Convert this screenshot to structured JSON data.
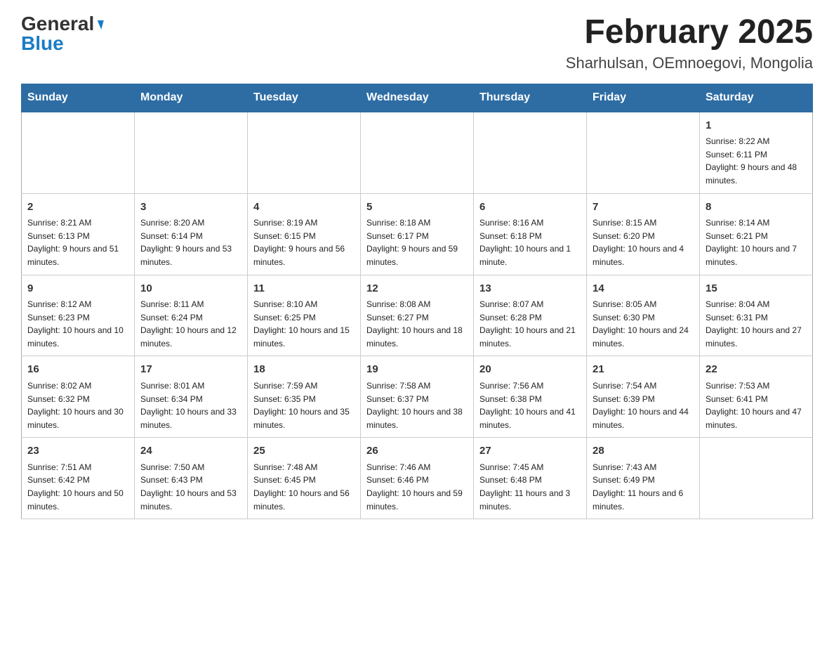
{
  "header": {
    "logo_general": "General",
    "logo_blue": "Blue",
    "month_title": "February 2025",
    "location": "Sharhulsan, OEmnoegovi, Mongolia"
  },
  "days_of_week": [
    "Sunday",
    "Monday",
    "Tuesday",
    "Wednesday",
    "Thursday",
    "Friday",
    "Saturday"
  ],
  "weeks": [
    [
      {
        "day": "",
        "info": ""
      },
      {
        "day": "",
        "info": ""
      },
      {
        "day": "",
        "info": ""
      },
      {
        "day": "",
        "info": ""
      },
      {
        "day": "",
        "info": ""
      },
      {
        "day": "",
        "info": ""
      },
      {
        "day": "1",
        "info": "Sunrise: 8:22 AM\nSunset: 6:11 PM\nDaylight: 9 hours and 48 minutes."
      }
    ],
    [
      {
        "day": "2",
        "info": "Sunrise: 8:21 AM\nSunset: 6:13 PM\nDaylight: 9 hours and 51 minutes."
      },
      {
        "day": "3",
        "info": "Sunrise: 8:20 AM\nSunset: 6:14 PM\nDaylight: 9 hours and 53 minutes."
      },
      {
        "day": "4",
        "info": "Sunrise: 8:19 AM\nSunset: 6:15 PM\nDaylight: 9 hours and 56 minutes."
      },
      {
        "day": "5",
        "info": "Sunrise: 8:18 AM\nSunset: 6:17 PM\nDaylight: 9 hours and 59 minutes."
      },
      {
        "day": "6",
        "info": "Sunrise: 8:16 AM\nSunset: 6:18 PM\nDaylight: 10 hours and 1 minute."
      },
      {
        "day": "7",
        "info": "Sunrise: 8:15 AM\nSunset: 6:20 PM\nDaylight: 10 hours and 4 minutes."
      },
      {
        "day": "8",
        "info": "Sunrise: 8:14 AM\nSunset: 6:21 PM\nDaylight: 10 hours and 7 minutes."
      }
    ],
    [
      {
        "day": "9",
        "info": "Sunrise: 8:12 AM\nSunset: 6:23 PM\nDaylight: 10 hours and 10 minutes."
      },
      {
        "day": "10",
        "info": "Sunrise: 8:11 AM\nSunset: 6:24 PM\nDaylight: 10 hours and 12 minutes."
      },
      {
        "day": "11",
        "info": "Sunrise: 8:10 AM\nSunset: 6:25 PM\nDaylight: 10 hours and 15 minutes."
      },
      {
        "day": "12",
        "info": "Sunrise: 8:08 AM\nSunset: 6:27 PM\nDaylight: 10 hours and 18 minutes."
      },
      {
        "day": "13",
        "info": "Sunrise: 8:07 AM\nSunset: 6:28 PM\nDaylight: 10 hours and 21 minutes."
      },
      {
        "day": "14",
        "info": "Sunrise: 8:05 AM\nSunset: 6:30 PM\nDaylight: 10 hours and 24 minutes."
      },
      {
        "day": "15",
        "info": "Sunrise: 8:04 AM\nSunset: 6:31 PM\nDaylight: 10 hours and 27 minutes."
      }
    ],
    [
      {
        "day": "16",
        "info": "Sunrise: 8:02 AM\nSunset: 6:32 PM\nDaylight: 10 hours and 30 minutes."
      },
      {
        "day": "17",
        "info": "Sunrise: 8:01 AM\nSunset: 6:34 PM\nDaylight: 10 hours and 33 minutes."
      },
      {
        "day": "18",
        "info": "Sunrise: 7:59 AM\nSunset: 6:35 PM\nDaylight: 10 hours and 35 minutes."
      },
      {
        "day": "19",
        "info": "Sunrise: 7:58 AM\nSunset: 6:37 PM\nDaylight: 10 hours and 38 minutes."
      },
      {
        "day": "20",
        "info": "Sunrise: 7:56 AM\nSunset: 6:38 PM\nDaylight: 10 hours and 41 minutes."
      },
      {
        "day": "21",
        "info": "Sunrise: 7:54 AM\nSunset: 6:39 PM\nDaylight: 10 hours and 44 minutes."
      },
      {
        "day": "22",
        "info": "Sunrise: 7:53 AM\nSunset: 6:41 PM\nDaylight: 10 hours and 47 minutes."
      }
    ],
    [
      {
        "day": "23",
        "info": "Sunrise: 7:51 AM\nSunset: 6:42 PM\nDaylight: 10 hours and 50 minutes."
      },
      {
        "day": "24",
        "info": "Sunrise: 7:50 AM\nSunset: 6:43 PM\nDaylight: 10 hours and 53 minutes."
      },
      {
        "day": "25",
        "info": "Sunrise: 7:48 AM\nSunset: 6:45 PM\nDaylight: 10 hours and 56 minutes."
      },
      {
        "day": "26",
        "info": "Sunrise: 7:46 AM\nSunset: 6:46 PM\nDaylight: 10 hours and 59 minutes."
      },
      {
        "day": "27",
        "info": "Sunrise: 7:45 AM\nSunset: 6:48 PM\nDaylight: 11 hours and 3 minutes."
      },
      {
        "day": "28",
        "info": "Sunrise: 7:43 AM\nSunset: 6:49 PM\nDaylight: 11 hours and 6 minutes."
      },
      {
        "day": "",
        "info": ""
      }
    ]
  ]
}
